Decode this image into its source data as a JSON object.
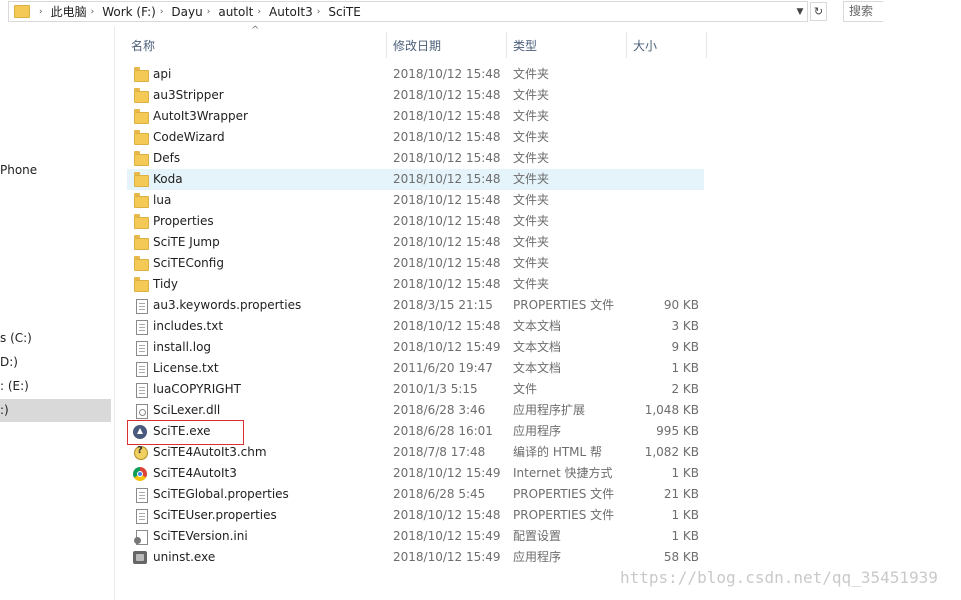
{
  "address": {
    "crumbs": [
      "此电脑",
      "Work (F:)",
      "Dayu",
      "autolt",
      "AutoIt3",
      "SciTE"
    ],
    "search_placeholder": "搜索"
  },
  "nav": {
    "items": [
      "Phone",
      "s (C:)",
      "D:)",
      ": (E:)",
      ":)"
    ],
    "selected": ":)"
  },
  "columns": {
    "name": "名称",
    "date": "修改日期",
    "type": "类型",
    "size": "大小"
  },
  "files": [
    {
      "name": "api",
      "date": "2018/10/12 15:48",
      "type": "文件夹",
      "size": "",
      "icon": "folder-icon"
    },
    {
      "name": "au3Stripper",
      "date": "2018/10/12 15:48",
      "type": "文件夹",
      "size": "",
      "icon": "folder-icon"
    },
    {
      "name": "AutoIt3Wrapper",
      "date": "2018/10/12 15:48",
      "type": "文件夹",
      "size": "",
      "icon": "folder-icon"
    },
    {
      "name": "CodeWizard",
      "date": "2018/10/12 15:48",
      "type": "文件夹",
      "size": "",
      "icon": "folder-icon"
    },
    {
      "name": "Defs",
      "date": "2018/10/12 15:48",
      "type": "文件夹",
      "size": "",
      "icon": "folder-icon"
    },
    {
      "name": "Koda",
      "date": "2018/10/12 15:48",
      "type": "文件夹",
      "size": "",
      "icon": "folder-icon"
    },
    {
      "name": "lua",
      "date": "2018/10/12 15:48",
      "type": "文件夹",
      "size": "",
      "icon": "folder-icon"
    },
    {
      "name": "Properties",
      "date": "2018/10/12 15:48",
      "type": "文件夹",
      "size": "",
      "icon": "folder-icon"
    },
    {
      "name": "SciTE Jump",
      "date": "2018/10/12 15:48",
      "type": "文件夹",
      "size": "",
      "icon": "folder-icon"
    },
    {
      "name": "SciTEConfig",
      "date": "2018/10/12 15:48",
      "type": "文件夹",
      "size": "",
      "icon": "folder-icon"
    },
    {
      "name": "Tidy",
      "date": "2018/10/12 15:48",
      "type": "文件夹",
      "size": "",
      "icon": "folder-icon"
    },
    {
      "name": "au3.keywords.properties",
      "date": "2018/3/15 21:15",
      "type": "PROPERTIES 文件",
      "size": "90 KB",
      "icon": "document-icon"
    },
    {
      "name": "includes.txt",
      "date": "2018/10/12 15:48",
      "type": "文本文档",
      "size": "3 KB",
      "icon": "text-document-icon"
    },
    {
      "name": "install.log",
      "date": "2018/10/12 15:49",
      "type": "文本文档",
      "size": "9 KB",
      "icon": "text-document-icon"
    },
    {
      "name": "License.txt",
      "date": "2011/6/20 19:47",
      "type": "文本文档",
      "size": "1 KB",
      "icon": "text-document-icon"
    },
    {
      "name": "luaCOPYRIGHT",
      "date": "2010/1/3 5:15",
      "type": "文件",
      "size": "2 KB",
      "icon": "document-icon"
    },
    {
      "name": "SciLexer.dll",
      "date": "2018/6/28 3:46",
      "type": "应用程序扩展",
      "size": "1,048 KB",
      "icon": "dll-icon"
    },
    {
      "name": "SciTE.exe",
      "date": "2018/6/28 16:01",
      "type": "应用程序",
      "size": "995 KB",
      "icon": "scite-app-icon"
    },
    {
      "name": "SciTE4AutoIt3.chm",
      "date": "2018/7/8 17:48",
      "type": "编译的 HTML 帮",
      "size": "1,082 KB",
      "icon": "help-file-icon"
    },
    {
      "name": "SciTE4AutoIt3",
      "date": "2018/10/12 15:49",
      "type": "Internet 快捷方式",
      "size": "1 KB",
      "icon": "internet-shortcut-icon"
    },
    {
      "name": "SciTEGlobal.properties",
      "date": "2018/6/28 5:45",
      "type": "PROPERTIES 文件",
      "size": "21 KB",
      "icon": "document-icon"
    },
    {
      "name": "SciTEUser.properties",
      "date": "2018/10/12 15:48",
      "type": "PROPERTIES 文件",
      "size": "1 KB",
      "icon": "document-icon"
    },
    {
      "name": "SciTEVersion.ini",
      "date": "2018/10/12 15:49",
      "type": "配置设置",
      "size": "1 KB",
      "icon": "settings-file-icon"
    },
    {
      "name": "uninst.exe",
      "date": "2018/10/12 15:49",
      "type": "应用程序",
      "size": "58 KB",
      "icon": "installer-icon"
    }
  ],
  "hovered_row": "Koda",
  "highlighted_item": "SciTE.exe",
  "watermark": "https://blog.csdn.net/qq_35451939",
  "colors": {
    "hover_row": "#e5f3fb",
    "highlight_box": "#d83030",
    "header_text": "#4c607a",
    "folder": "#f4c955"
  }
}
